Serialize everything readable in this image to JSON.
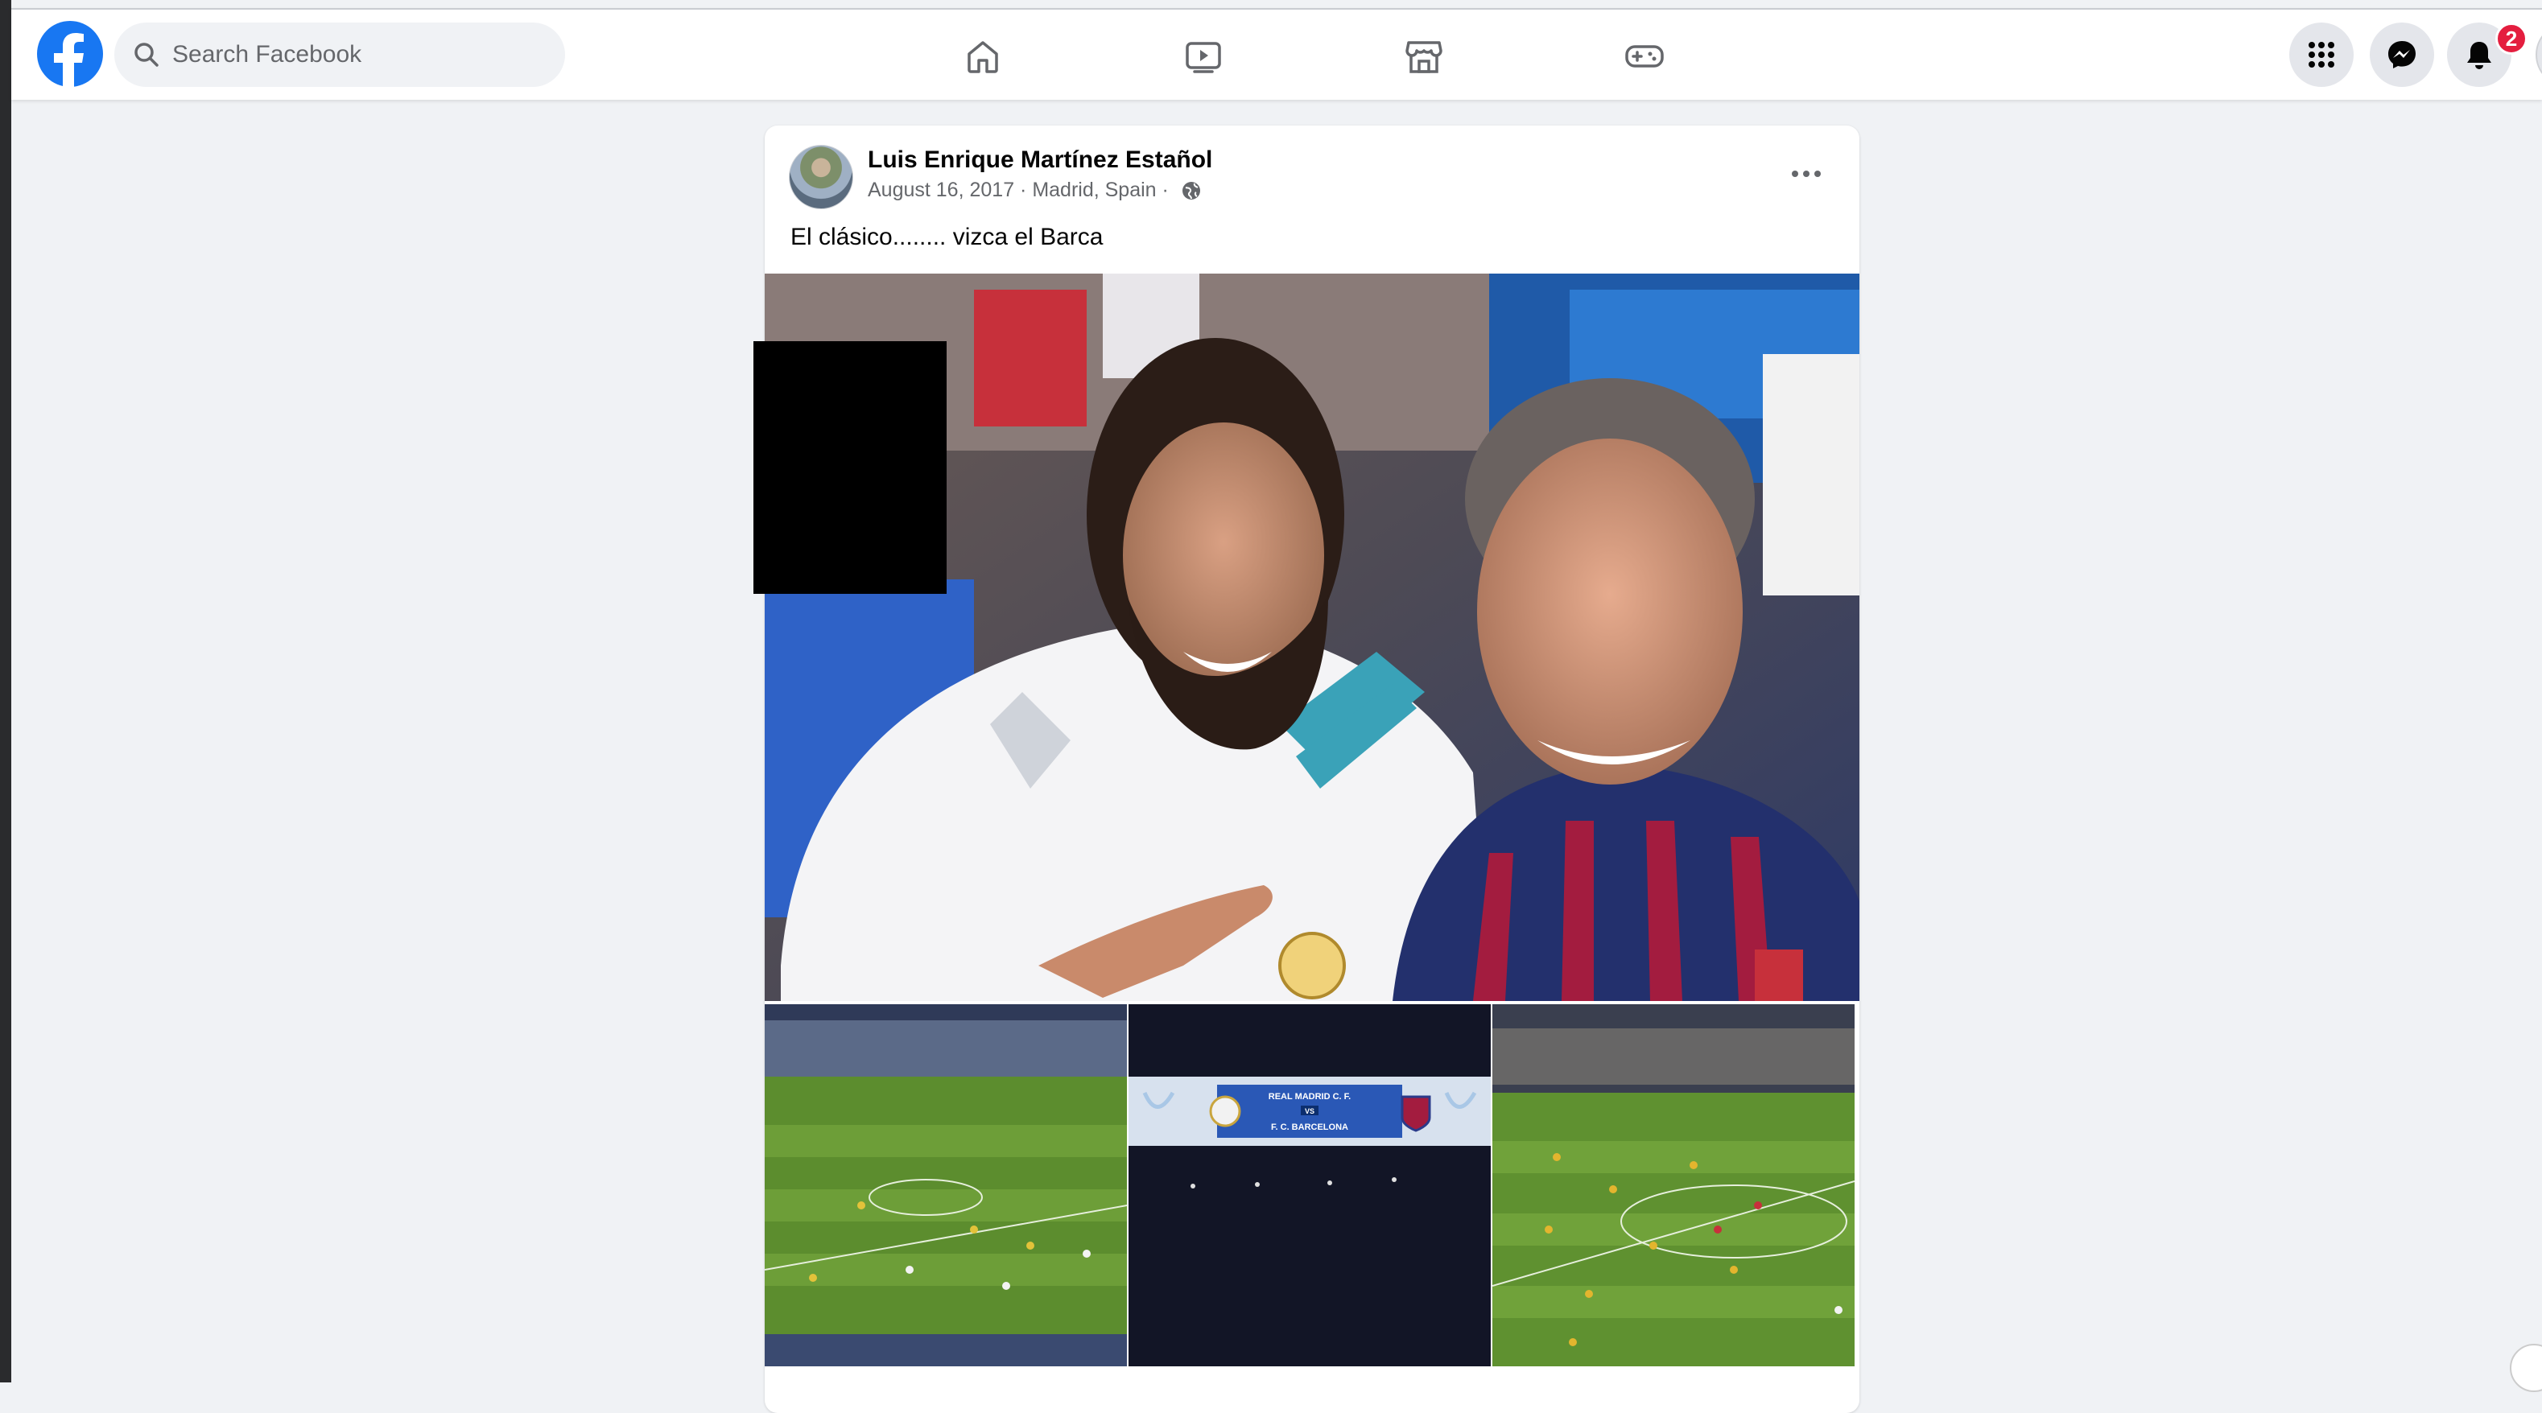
{
  "topbar": {
    "search_placeholder": "Search Facebook",
    "notification_count": "2",
    "nav_tabs": [
      "home-icon",
      "watch-icon",
      "marketplace-icon",
      "gaming-icon"
    ],
    "right_buttons": [
      "menu-grid-icon",
      "messenger-icon",
      "bell-icon"
    ]
  },
  "post": {
    "author": "Luis Enrique Martínez Estañol",
    "date": "August 16, 2017",
    "location": "Madrid, Spain",
    "meta_sep": " · ",
    "privacy_icon": "globe-icon",
    "text": "El clásico........ vizca el Barca",
    "scoreboard_top": "REAL MADRID C. F.",
    "scoreboard_vs": "VS",
    "scoreboard_bottom": "F. C. BARCELONA"
  },
  "colors": {
    "facebook_blue": "#1877f2",
    "background": "#f0f2f5",
    "badge_red": "#e41e3f"
  }
}
